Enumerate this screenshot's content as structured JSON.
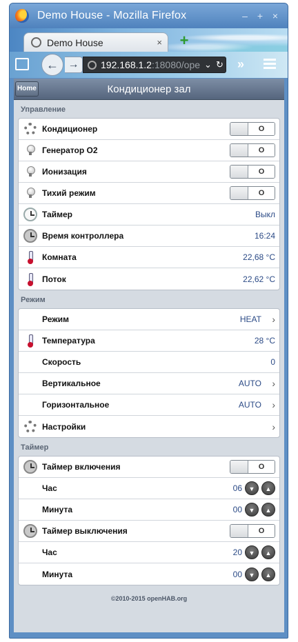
{
  "window": {
    "title": "Demo House - Mozilla Firefox",
    "min": "–",
    "max": "+",
    "close": "×"
  },
  "tab": {
    "label": "Demo House",
    "close": "×",
    "new_tab": "+"
  },
  "nav": {
    "back": "←",
    "forward": "→",
    "url_host": "192.168.1.2",
    "url_rest": ":18080/ope",
    "dropdown": "⌄",
    "reload": "↻",
    "overflow": "»"
  },
  "header": {
    "home": "Home",
    "title": "Кондиционер зал"
  },
  "sections": {
    "control": {
      "title": "Управление",
      "items": [
        {
          "label": "Кондиционер",
          "icon": "gear-icon",
          "toggle": "O"
        },
        {
          "label": "Генератор O2",
          "icon": "bulb-icon",
          "toggle": "O"
        },
        {
          "label": "Ионизация",
          "icon": "bulb-icon",
          "toggle": "O"
        },
        {
          "label": "Тихий режим",
          "icon": "bulb-icon",
          "toggle": "O"
        },
        {
          "label": "Таймер",
          "icon": "clock-icon",
          "value": "Выкл"
        },
        {
          "label": "Время контроллера",
          "icon": "clock-icon",
          "value": "16:24"
        },
        {
          "label": "Комната",
          "icon": "thermometer-icon",
          "value": "22,68 °C"
        },
        {
          "label": "Поток",
          "icon": "thermometer-icon",
          "value": "22,62 °C"
        }
      ]
    },
    "mode": {
      "title": "Режим",
      "items": [
        {
          "label": "Режим",
          "value": "HEAT",
          "chevron": "›"
        },
        {
          "label": "Температура",
          "icon": "thermometer-icon",
          "value": "28 °C"
        },
        {
          "label": "Скорость",
          "value": "0"
        },
        {
          "label": "Вертикальное",
          "value": "AUTO",
          "chevron": "›"
        },
        {
          "label": "Горизонтальное",
          "value": "AUTO",
          "chevron": "›"
        },
        {
          "label": "Настройки",
          "icon": "gear-icon",
          "chevron": "›"
        }
      ]
    },
    "timer": {
      "title": "Таймер",
      "items": [
        {
          "label": "Таймер включения",
          "icon": "clock-icon",
          "toggle": "O"
        },
        {
          "label": "Час",
          "value": "06",
          "down": "▼",
          "up": "▲"
        },
        {
          "label": "Минута",
          "value": "00",
          "down": "▼",
          "up": "▲"
        },
        {
          "label": "Таймер выключения",
          "icon": "clock-icon",
          "toggle": "O"
        },
        {
          "label": "Час",
          "value": "20",
          "down": "▼",
          "up": "▲"
        },
        {
          "label": "Минута",
          "value": "00",
          "down": "▼",
          "up": "▲"
        }
      ]
    }
  },
  "footer": "©2010-2015 openHAB.org"
}
